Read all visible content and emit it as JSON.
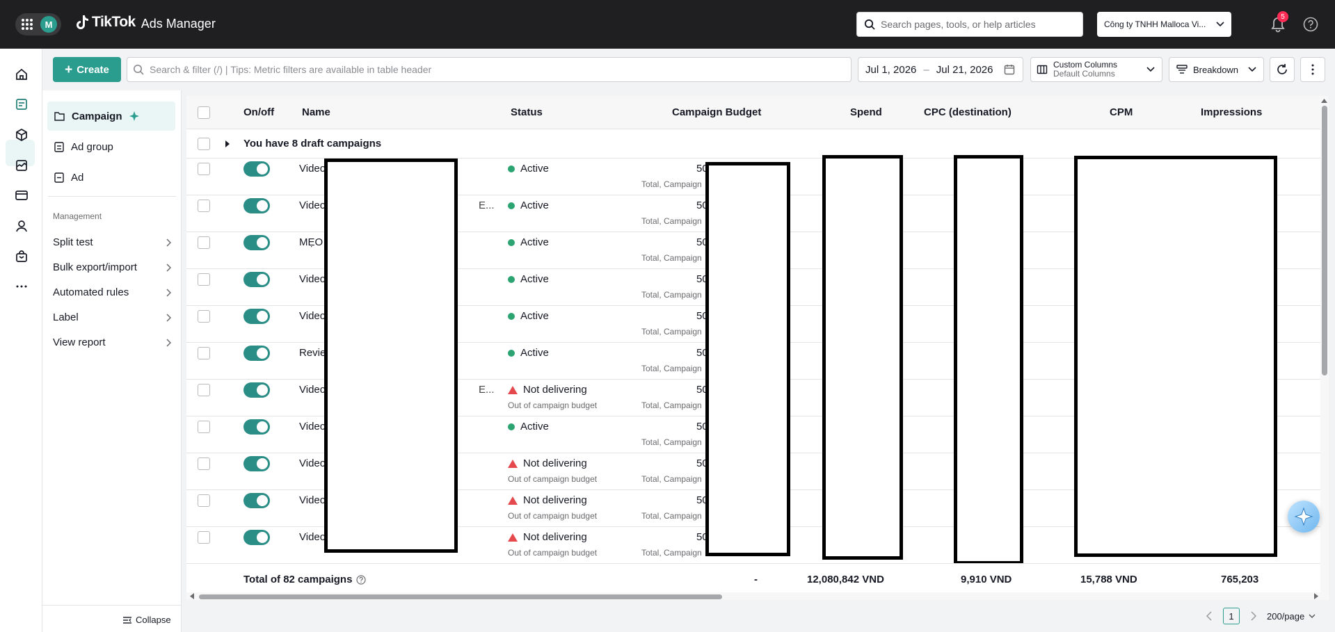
{
  "app": {
    "brand": "TikTok",
    "product": "Ads Manager",
    "avatar_letter": "M"
  },
  "header": {
    "search_placeholder": "Search pages, tools, or help articles",
    "account_name": "Công ty TNHH Malloca Vi...",
    "notifications_count": "5"
  },
  "sidebar": {
    "items": [
      {
        "label": "Campaign"
      },
      {
        "label": "Ad group"
      },
      {
        "label": "Ad"
      }
    ],
    "management_title": "Management",
    "management_items": [
      {
        "label": "Split test"
      },
      {
        "label": "Bulk export/import"
      },
      {
        "label": "Automated rules"
      },
      {
        "label": "Label"
      },
      {
        "label": "View report"
      }
    ],
    "collapse_label": "Collapse"
  },
  "toolbar": {
    "create_label": "Create",
    "filter_placeholder": "Search & filter (/) | Tips: Metric filters are available in table header",
    "date_start": "Jul 1, 2026",
    "date_sep": "–",
    "date_end": "Jul 21, 2026",
    "columns_title": "Custom Columns",
    "columns_sub": "Default Columns",
    "breakdown_label": "Breakdown"
  },
  "table": {
    "headers": {
      "onoff": "On/off",
      "name": "Name",
      "status": "Status",
      "budget": "Campaign Budget",
      "spend": "Spend",
      "cpc": "CPC (destination)",
      "cpm": "CPM",
      "impressions": "Impressions"
    },
    "draft_text": "You have 8 draft campaigns",
    "rows": [
      {
        "name": "Video",
        "trunc": "",
        "status": "Active",
        "delivering": true,
        "sub": "",
        "budget": "50",
        "budget_sub": "Total, Campaign"
      },
      {
        "name": "Video",
        "trunc": "E...",
        "status": "Active",
        "delivering": true,
        "sub": "",
        "budget": "50",
        "budget_sub": "Total, Campaign"
      },
      {
        "name": "MẸO V",
        "trunc": "",
        "status": "Active",
        "delivering": true,
        "sub": "",
        "budget": "50",
        "budget_sub": "Total, Campaign"
      },
      {
        "name": "Video",
        "trunc": "",
        "status": "Active",
        "delivering": true,
        "sub": "",
        "budget": "50",
        "budget_sub": "Total, Campaign"
      },
      {
        "name": "Video",
        "trunc": "",
        "status": "Active",
        "delivering": true,
        "sub": "",
        "budget": "50",
        "budget_sub": "Total, Campaign"
      },
      {
        "name": "Review",
        "trunc": "",
        "status": "Active",
        "delivering": true,
        "sub": "",
        "budget": "50",
        "budget_sub": "Total, Campaign"
      },
      {
        "name": "Video",
        "trunc": "E...",
        "status": "Not delivering",
        "delivering": false,
        "sub": "Out of campaign budget",
        "budget": "50",
        "budget_sub": "Total, Campaign"
      },
      {
        "name": "Video",
        "trunc": "",
        "status": "Active",
        "delivering": true,
        "sub": "",
        "budget": "50",
        "budget_sub": "Total, Campaign"
      },
      {
        "name": "Video",
        "trunc": "",
        "status": "Not delivering",
        "delivering": false,
        "sub": "Out of campaign budget",
        "budget": "50",
        "budget_sub": "Total, Campaign"
      },
      {
        "name": "Video",
        "trunc": "",
        "status": "Not delivering",
        "delivering": false,
        "sub": "Out of campaign budget",
        "budget": "50",
        "budget_sub": "Total, Campaign"
      },
      {
        "name": "Video",
        "trunc": "",
        "status": "Not delivering",
        "delivering": false,
        "sub": "Out of campaign budget",
        "budget": "50",
        "budget_sub": "Total, Campaign"
      }
    ],
    "footer": {
      "label": "Total of 82 campaigns",
      "budget": "-",
      "spend": "12,080,842 VND",
      "cpc": "9,910 VND",
      "cpm": "15,788 VND",
      "impressions": "765,203"
    }
  },
  "pagination": {
    "current_page": "1",
    "per_page": "200/page"
  },
  "colors": {
    "accent": "#2a9d8f",
    "active": "#2ba471",
    "warning": "#e5484d",
    "topbar": "#1f1f22"
  }
}
